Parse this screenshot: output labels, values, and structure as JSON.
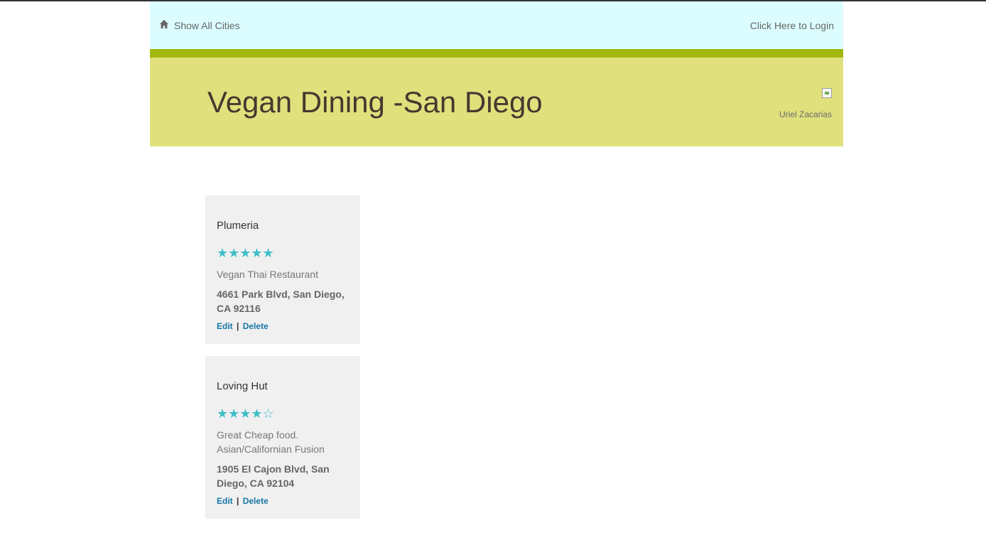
{
  "nav": {
    "home_label": "Show All Cities",
    "login_label": "Click Here to Login"
  },
  "header": {
    "title": "Vegan Dining -San Diego",
    "author": "Uriel Zacarias"
  },
  "colors": {
    "nav_bg": "#dcfdff",
    "accent_bar": "#a3b80c",
    "hero_bg": "#e0e07d",
    "star": "#3ebec8",
    "link": "#1577a8"
  },
  "restaurants": [
    {
      "name": "Plumeria",
      "stars": "★★★★★",
      "rating": 5,
      "description": "Vegan Thai Restaurant",
      "address": "4661 Park Blvd, San Diego, CA 92116",
      "edit_label": "Edit",
      "separator": "|",
      "delete_label": "Delete"
    },
    {
      "name": "Loving Hut",
      "stars": "★★★★☆",
      "rating": 4,
      "description": "Great Cheap food. Asian/Californian Fusion",
      "address": "1905 El Cajon Blvd, San Diego, CA 92104",
      "edit_label": "Edit",
      "separator": "|",
      "delete_label": "Delete"
    }
  ]
}
